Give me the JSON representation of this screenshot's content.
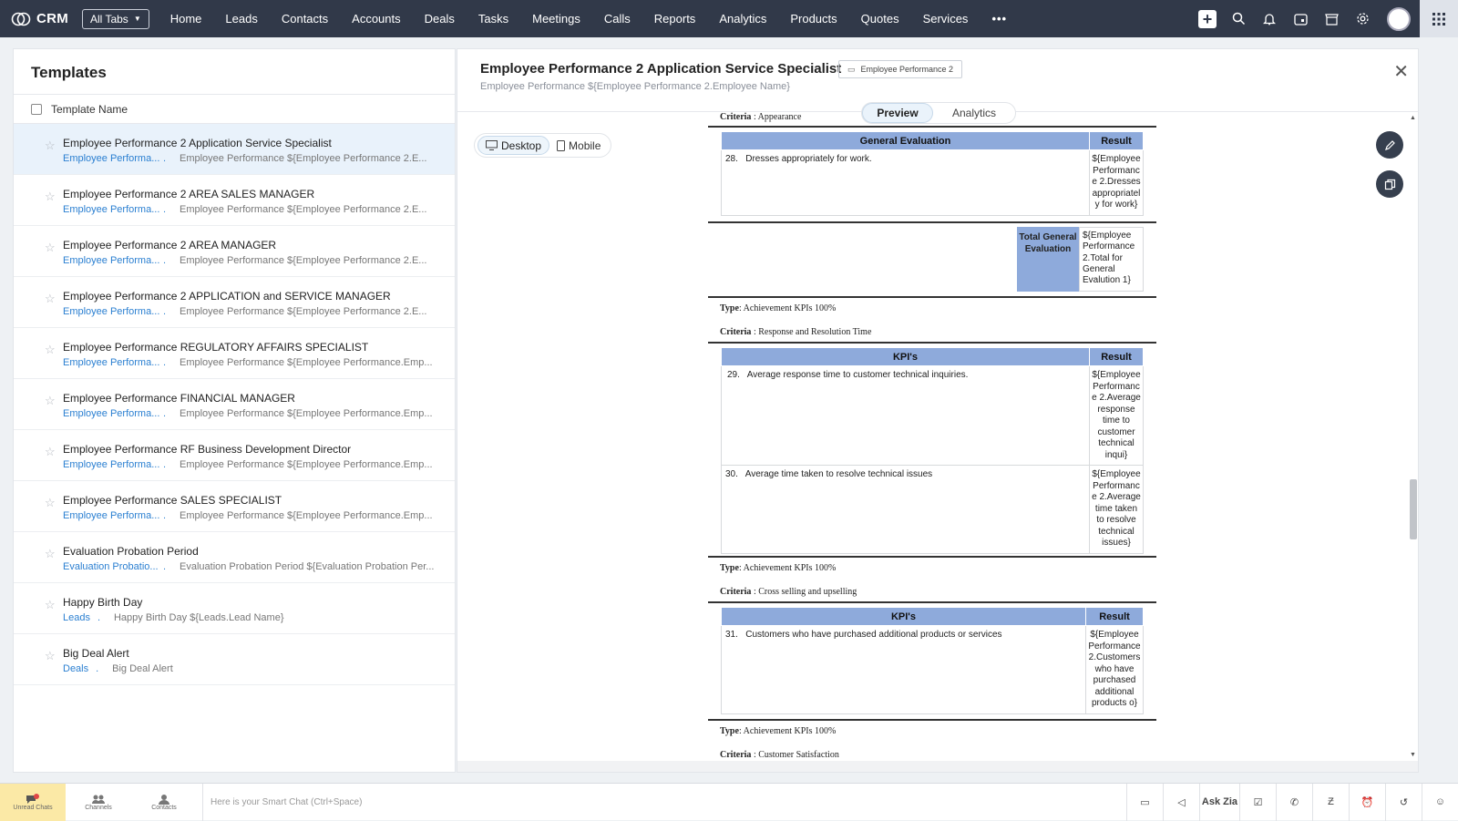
{
  "topbar": {
    "app_name": "CRM",
    "all_tabs": "All Tabs",
    "nav": [
      "Home",
      "Leads",
      "Contacts",
      "Accounts",
      "Deals",
      "Tasks",
      "Meetings",
      "Calls",
      "Reports",
      "Analytics",
      "Products",
      "Quotes",
      "Services"
    ],
    "more": "•••",
    "icons": [
      "plus-icon",
      "search-icon",
      "bell-icon",
      "calendar-icon",
      "marketplace-icon",
      "gear-icon",
      "avatar",
      "grid-menu-icon"
    ]
  },
  "templates": {
    "title": "Templates",
    "column_header": "Template Name",
    "items": [
      {
        "name": "Employee Performance 2 Application Service Specialist",
        "module": "Employee Performa...",
        "subject": "Employee Performance ${Employee Performance 2.E..."
      },
      {
        "name": "Employee Performance 2 AREA SALES MANAGER",
        "module": "Employee Performa...",
        "subject": "Employee Performance ${Employee Performance 2.E..."
      },
      {
        "name": "Employee Performance 2 AREA MANAGER",
        "module": "Employee Performa...",
        "subject": "Employee Performance ${Employee Performance 2.E..."
      },
      {
        "name": "Employee Performance 2 APPLICATION and SERVICE MANAGER",
        "module": "Employee Performa...",
        "subject": "Employee Performance ${Employee Performance 2.E..."
      },
      {
        "name": "Employee Performance REGULATORY AFFAIRS SPECIALIST",
        "module": "Employee Performa...",
        "subject": "Employee Performance ${Employee Performance.Emp..."
      },
      {
        "name": "Employee Performance FINANCIAL MANAGER",
        "module": "Employee Performa...",
        "subject": "Employee Performance ${Employee Performance.Emp..."
      },
      {
        "name": "Employee Performance RF Business Development Director",
        "module": "Employee Performa...",
        "subject": "Employee Performance ${Employee Performance.Emp..."
      },
      {
        "name": "Employee Performance SALES SPECIALIST",
        "module": "Employee Performa...",
        "subject": "Employee Performance ${Employee Performance.Emp..."
      },
      {
        "name": "Evaluation Probation Period",
        "module": "Evaluation Probatio...",
        "subject": "Evaluation Probation Period ${Evaluation Probation Per..."
      },
      {
        "name": "Happy Birth Day",
        "module": "Leads",
        "subject": "Happy Birth Day ${Leads.Lead Name}"
      },
      {
        "name": "Big Deal Alert",
        "module": "Deals",
        "subject": "Big Deal Alert"
      }
    ],
    "dot": "."
  },
  "preview": {
    "title": "Employee Performance 2 Application Service Specialist",
    "badge": "Employee Performance 2",
    "subject": "Employee Performance ${Employee Performance 2.Employee Name}",
    "tabs": {
      "preview": "Preview",
      "analytics": "Analytics"
    },
    "devices": {
      "desktop": "Desktop",
      "mobile": "Mobile"
    },
    "doc": {
      "crit_appearance_label": "Criteria",
      "crit_appearance_value": " : Appearance",
      "table1": {
        "h1": "General Evaluation",
        "h2": "Result",
        "r_num": "28.",
        "r_text": "Dresses appropriately for work.",
        "r_res": "${Employee Performanc e 2.Dresses appropriatel y for work}"
      },
      "total": {
        "label": "Total General Evaluation",
        "value": "${Employee Performance 2.Total for General Evalution 1}"
      },
      "type1_label": "Type",
      "type1_value": ": Achievement KPIs 100%",
      "crit2_label": "Criteria",
      "crit2_value": " : Response and Resolution Time",
      "table2": {
        "h1": "KPI's",
        "h2": "Result",
        "r1_num": "29.",
        "r1_text": "Average response time to customer technical inquiries.",
        "r1_res": "${Employee Performanc e 2.Average response time to customer technical inqui}",
        "r2_num": "30.",
        "r2_text": "Average time taken to resolve technical issues",
        "r2_res": "${Employee Performanc e 2.Average time taken to resolve technical issues}"
      },
      "type2_label": "Type",
      "type2_value": ": Achievement KPIs 100%",
      "crit3_label": "Criteria",
      "crit3_value": " : Cross selling and upselling",
      "table3": {
        "h1": "KPI's",
        "h2": "Result",
        "r_num": "31.",
        "r_text": "Customers who have purchased additional products or services",
        "r_res": "${Employee Performance 2.Customers who have purchased additional products o}"
      },
      "type3_label": "Type",
      "type3_value": ": Achievement KPIs 100%",
      "crit4_label": "Criteria",
      "crit4_value": " : Customer Satisfaction"
    }
  },
  "bottombar": {
    "unread": "Unread Chats",
    "channels": "Channels",
    "contacts": "Contacts",
    "smart_chat": "Here is your Smart Chat (Ctrl+Space)",
    "ask_zia": "Ask Zia"
  }
}
